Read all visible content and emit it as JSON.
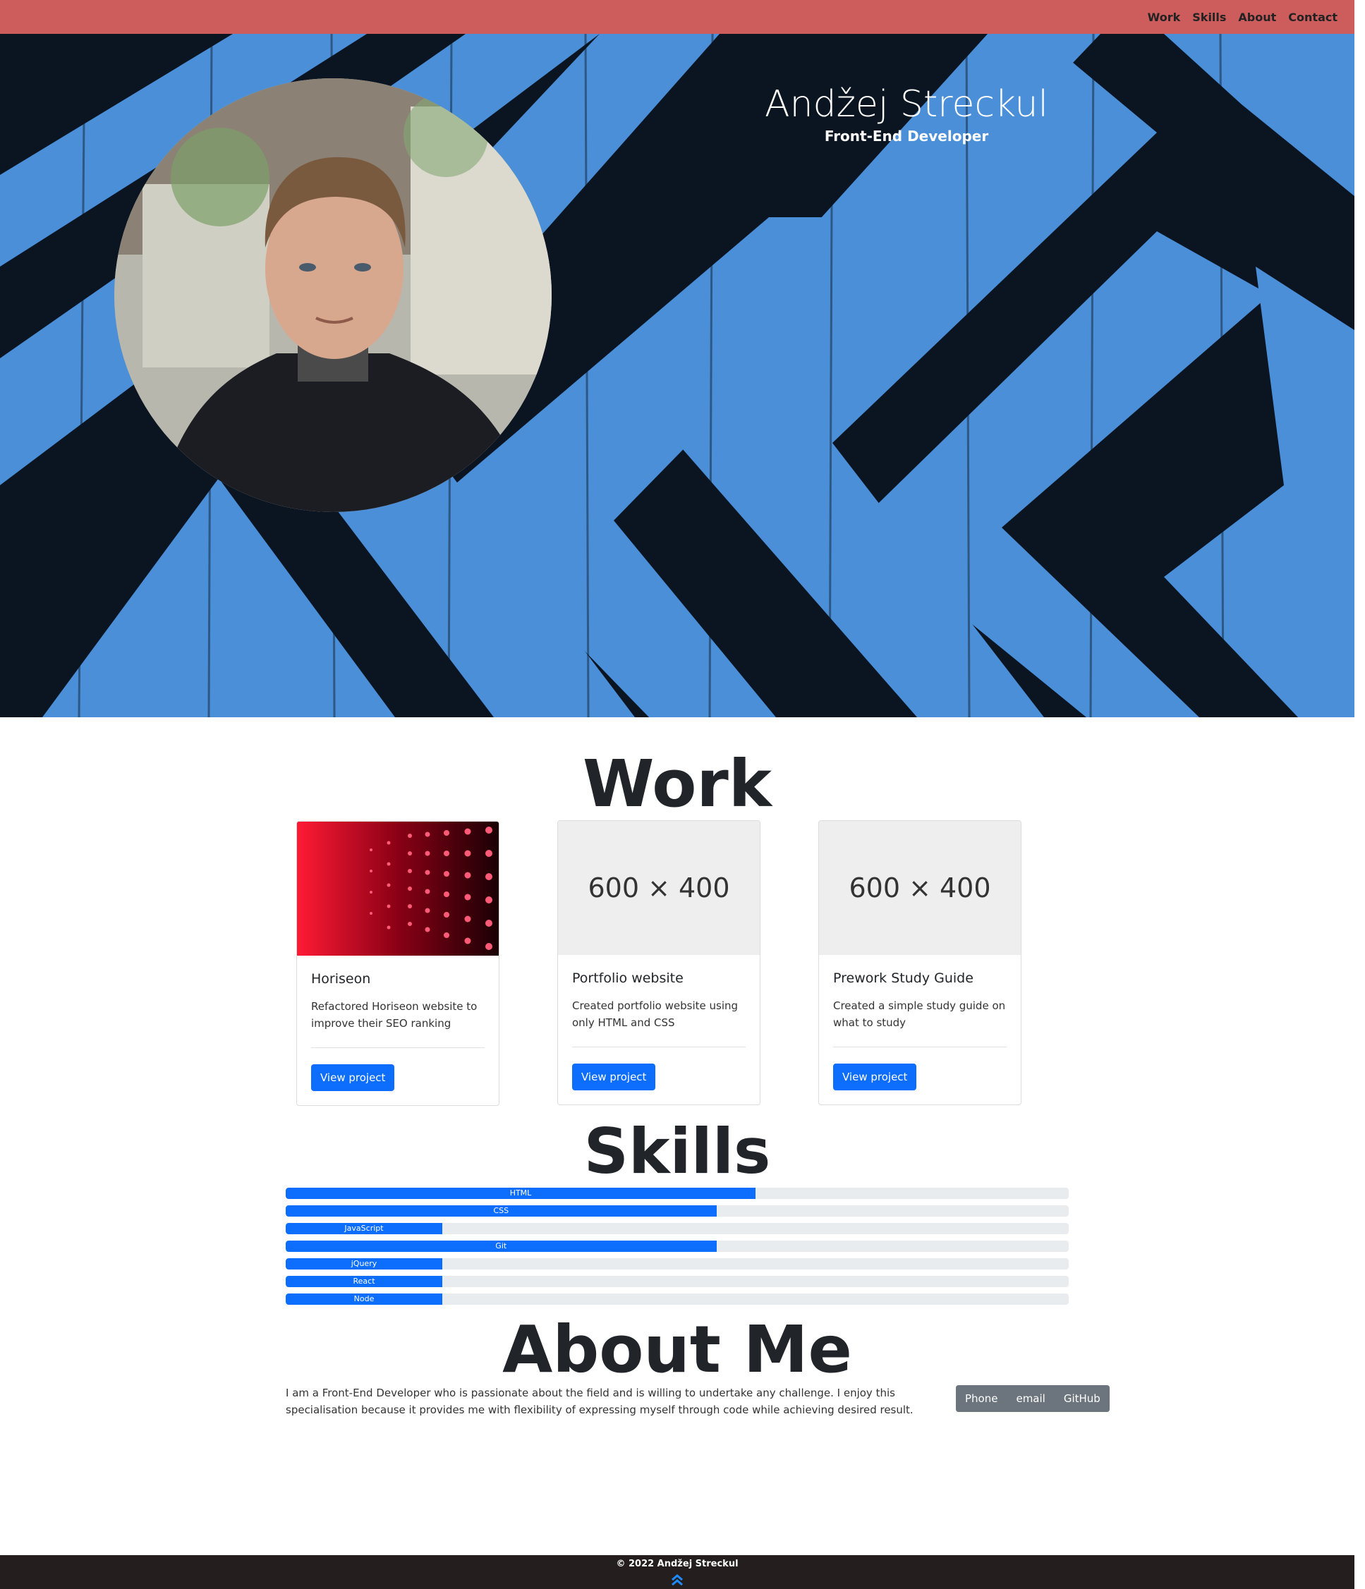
{
  "nav": {
    "items": [
      {
        "label": "Work"
      },
      {
        "label": "Skills"
      },
      {
        "label": "About"
      },
      {
        "label": "Contact"
      }
    ],
    "background": "#cd5c5c"
  },
  "hero": {
    "name": "Andžej Streckul",
    "role": "Front-End Developer",
    "colors": {
      "stripe_blue": "#4a8fd8",
      "dark": "#0b1522"
    }
  },
  "work": {
    "title": "Work",
    "projects": [
      {
        "title": "Horiseon",
        "description": "Refactored Horiseon website to improve their SEO ranking",
        "button": "View project",
        "image": "red-led-grid"
      },
      {
        "title": "Portfolio website",
        "description": "Created portfolio website using only HTML and CSS",
        "button": "View project",
        "image_placeholder": "600 × 400"
      },
      {
        "title": "Prework Study Guide",
        "description": "Created a simple study guide on what to study",
        "button": "View project",
        "image_placeholder": "600 × 400"
      }
    ],
    "button_color": "#0d6efd"
  },
  "skills": {
    "title": "Skills",
    "items": [
      {
        "name": "HTML",
        "level": 0.6
      },
      {
        "name": "CSS",
        "level": 0.55
      },
      {
        "name": "JavaScript",
        "level": 0.2
      },
      {
        "name": "Git",
        "level": 0.55
      },
      {
        "name": "jQuery",
        "level": 0.2
      },
      {
        "name": "React",
        "level": 0.2
      },
      {
        "name": "Node",
        "level": 0.2
      }
    ]
  },
  "about": {
    "title": "About Me",
    "text": "I am a Front-End Developer who is passionate about the field and is willing to undertake any challenge. I enjoy this specialisation because it provides me with flexibility of expressing myself through code while achieving desired result.",
    "contacts": [
      {
        "label": "Phone"
      },
      {
        "label": "email"
      },
      {
        "label": "GitHub"
      }
    ]
  },
  "footer": {
    "text": "© 2022 Andžej Streckul",
    "scroll_top_icon": "double-chevron-up-icon"
  }
}
